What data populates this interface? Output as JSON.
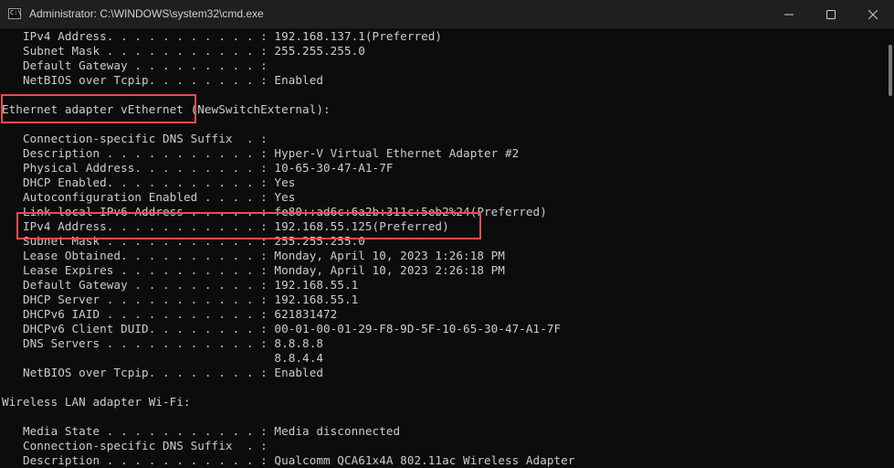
{
  "window": {
    "title": "Administrator: C:\\WINDOWS\\system32\\cmd.exe",
    "icon": "cmd-icon",
    "icon_glyph": "C:\\",
    "controls": [
      "minimize-icon",
      "maximize-icon",
      "close-icon"
    ]
  },
  "console": {
    "lines": [
      "   IPv4 Address. . . . . . . . . . . : 192.168.137.1(Preferred)",
      "   Subnet Mask . . . . . . . . . . . : 255.255.255.0",
      "   Default Gateway . . . . . . . . . :",
      "   NetBIOS over Tcpip. . . . . . . . : Enabled",
      "",
      "Ethernet adapter vEthernet (NewSwitchExternal):",
      "",
      "   Connection-specific DNS Suffix  . :",
      "   Description . . . . . . . . . . . : Hyper-V Virtual Ethernet Adapter #2",
      "   Physical Address. . . . . . . . . : 10-65-30-47-A1-7F",
      "   DHCP Enabled. . . . . . . . . . . : Yes",
      "   Autoconfiguration Enabled . . . . : Yes",
      "   Link-local IPv6 Address . . . . . : fe80::ad6c:6a2b:311c:5eb2%24(Preferred)",
      "   IPv4 Address. . . . . . . . . . . : 192.168.55.125(Preferred)",
      "   Subnet Mask . . . . . . . . . . . : 255.255.255.0",
      "   Lease Obtained. . . . . . . . . . : Monday, April 10, 2023 1:26:18 PM",
      "   Lease Expires . . . . . . . . . . : Monday, April 10, 2023 2:26:18 PM",
      "   Default Gateway . . . . . . . . . : 192.168.55.1",
      "   DHCP Server . . . . . . . . . . . : 192.168.55.1",
      "   DHCPv6 IAID . . . . . . . . . . . : 621831472",
      "   DHCPv6 Client DUID. . . . . . . . : 00-01-00-01-29-F8-9D-5F-10-65-30-47-A1-7F",
      "   DNS Servers . . . . . . . . . . . : 8.8.8.8",
      "                                       8.8.4.4",
      "   NetBIOS over Tcpip. . . . . . . . : Enabled",
      "",
      "Wireless LAN adapter Wi-Fi:",
      "",
      "   Media State . . . . . . . . . . . : Media disconnected",
      "   Connection-specific DNS Suffix  . :",
      "   Description . . . . . . . . . . . : Qualcomm QCA61x4A 802.11ac Wireless Adapter"
    ]
  },
  "highlights": [
    {
      "label": "adapter-name-highlight",
      "color": "#e25050"
    },
    {
      "label": "ipv4-address-highlight",
      "color": "#e25050"
    }
  ],
  "colors": {
    "background": "#0c0c0c",
    "text": "#cccccc",
    "titlebar": "#1f1f1f",
    "highlight": "#e25050"
  }
}
